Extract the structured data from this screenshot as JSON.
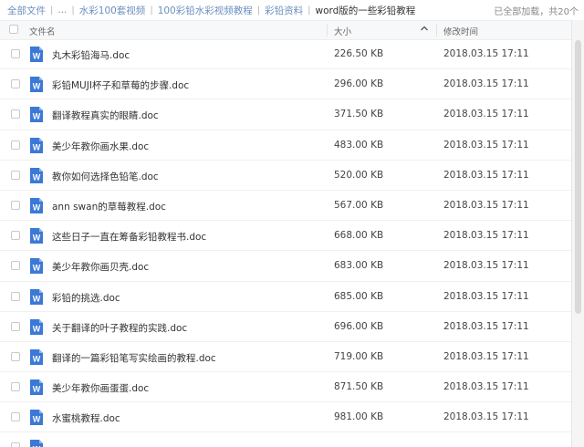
{
  "breadcrumb": {
    "items": [
      "全部文件",
      "...",
      "水彩100套视频",
      "100彩铅水彩视频教程",
      "彩铅资料",
      "word版的一些彩铅教程"
    ],
    "separator": "|"
  },
  "status": "已全部加载，共20个",
  "columns": {
    "name": "文件名",
    "size": "大小",
    "modified": "修改时间"
  },
  "colors": {
    "link": "#6b8fbf",
    "doc_icon": "#3c79d6",
    "header_bg": "#f7f8fa"
  },
  "files": [
    {
      "name": "丸木彩铅海马.doc",
      "size": "226.50 KB",
      "modified": "2018.03.15 17:11",
      "icon": "word-doc-icon"
    },
    {
      "name": "彩铅MUJI杯子和草莓的步骤.doc",
      "size": "296.00 KB",
      "modified": "2018.03.15 17:11",
      "icon": "word-doc-icon"
    },
    {
      "name": "翻译教程真实的眼睛.doc",
      "size": "371.50 KB",
      "modified": "2018.03.15 17:11",
      "icon": "word-doc-icon"
    },
    {
      "name": "美少年教你画水果.doc",
      "size": "483.00 KB",
      "modified": "2018.03.15 17:11",
      "icon": "word-doc-icon"
    },
    {
      "name": "教你如何选择色铅笔.doc",
      "size": "520.00 KB",
      "modified": "2018.03.15 17:11",
      "icon": "word-doc-icon"
    },
    {
      "name": "ann swan的草莓教程.doc",
      "size": "567.00 KB",
      "modified": "2018.03.15 17:11",
      "icon": "word-doc-icon"
    },
    {
      "name": "这些日子一直在筹备彩铅教程书.doc",
      "size": "668.00 KB",
      "modified": "2018.03.15 17:11",
      "icon": "word-doc-icon"
    },
    {
      "name": "美少年教你画贝壳.doc",
      "size": "683.00 KB",
      "modified": "2018.03.15 17:11",
      "icon": "word-doc-icon"
    },
    {
      "name": "彩铅的挑选.doc",
      "size": "685.00 KB",
      "modified": "2018.03.15 17:11",
      "icon": "word-doc-icon"
    },
    {
      "name": "关于翻译的叶子教程的实践.doc",
      "size": "696.00 KB",
      "modified": "2018.03.15 17:11",
      "icon": "word-doc-icon"
    },
    {
      "name": "翻译的一篇彩铅笔写实绘画的教程.doc",
      "size": "719.00 KB",
      "modified": "2018.03.15 17:11",
      "icon": "word-doc-icon"
    },
    {
      "name": "美少年教你画蛋蛋.doc",
      "size": "871.50 KB",
      "modified": "2018.03.15 17:11",
      "icon": "word-doc-icon"
    },
    {
      "name": "水蜜桃教程.doc",
      "size": "981.00 KB",
      "modified": "2018.03.15 17:11",
      "icon": "word-doc-icon"
    },
    {
      "name": "",
      "size": "",
      "modified": "",
      "icon": "word-doc-icon"
    }
  ]
}
